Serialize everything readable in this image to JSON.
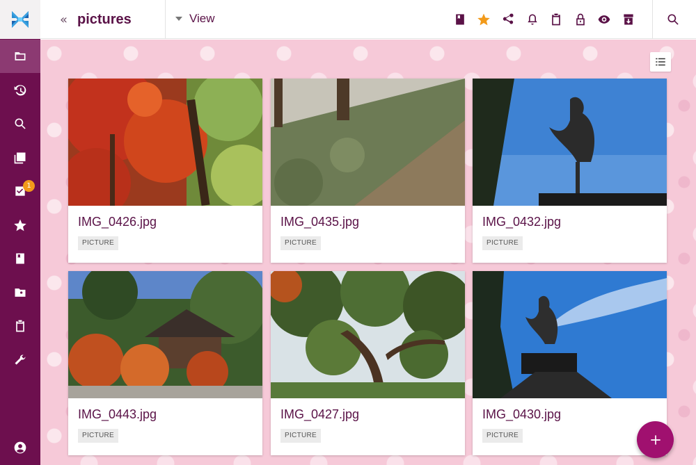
{
  "app": {
    "logo_icon": "cross-logo-icon",
    "brand_color": "#6d0f4e",
    "accent_color": "#f29a1a"
  },
  "header": {
    "back_label": "«",
    "title": "pictures",
    "view_label": "View",
    "actions": [
      "book-icon",
      "star-icon",
      "share-icon",
      "bell-icon",
      "clipboard-icon",
      "lock-icon",
      "eye-icon",
      "archive-icon",
      "search-icon"
    ]
  },
  "sidebar": {
    "items": [
      {
        "icon": "folder-icon",
        "active": true
      },
      {
        "icon": "history-icon"
      },
      {
        "icon": "search-icon"
      },
      {
        "icon": "photos-icon"
      },
      {
        "icon": "tasks-icon",
        "badge": "1"
      },
      {
        "icon": "star-icon"
      },
      {
        "icon": "book-icon"
      },
      {
        "icon": "contacts-icon"
      },
      {
        "icon": "clipboard-icon"
      },
      {
        "icon": "wrench-icon"
      },
      {
        "icon": "account-icon"
      }
    ]
  },
  "files": [
    {
      "name": "IMG_0426.jpg",
      "type": "PICTURE"
    },
    {
      "name": "IMG_0435.jpg",
      "type": "PICTURE"
    },
    {
      "name": "IMG_0432.jpg",
      "type": "PICTURE"
    },
    {
      "name": "IMG_0443.jpg",
      "type": "PICTURE"
    },
    {
      "name": "IMG_0427.jpg",
      "type": "PICTURE"
    },
    {
      "name": "IMG_0430.jpg",
      "type": "PICTURE"
    }
  ],
  "fab": {
    "icon": "plus-icon"
  },
  "view_toggle": {
    "icon": "list-view-icon"
  }
}
